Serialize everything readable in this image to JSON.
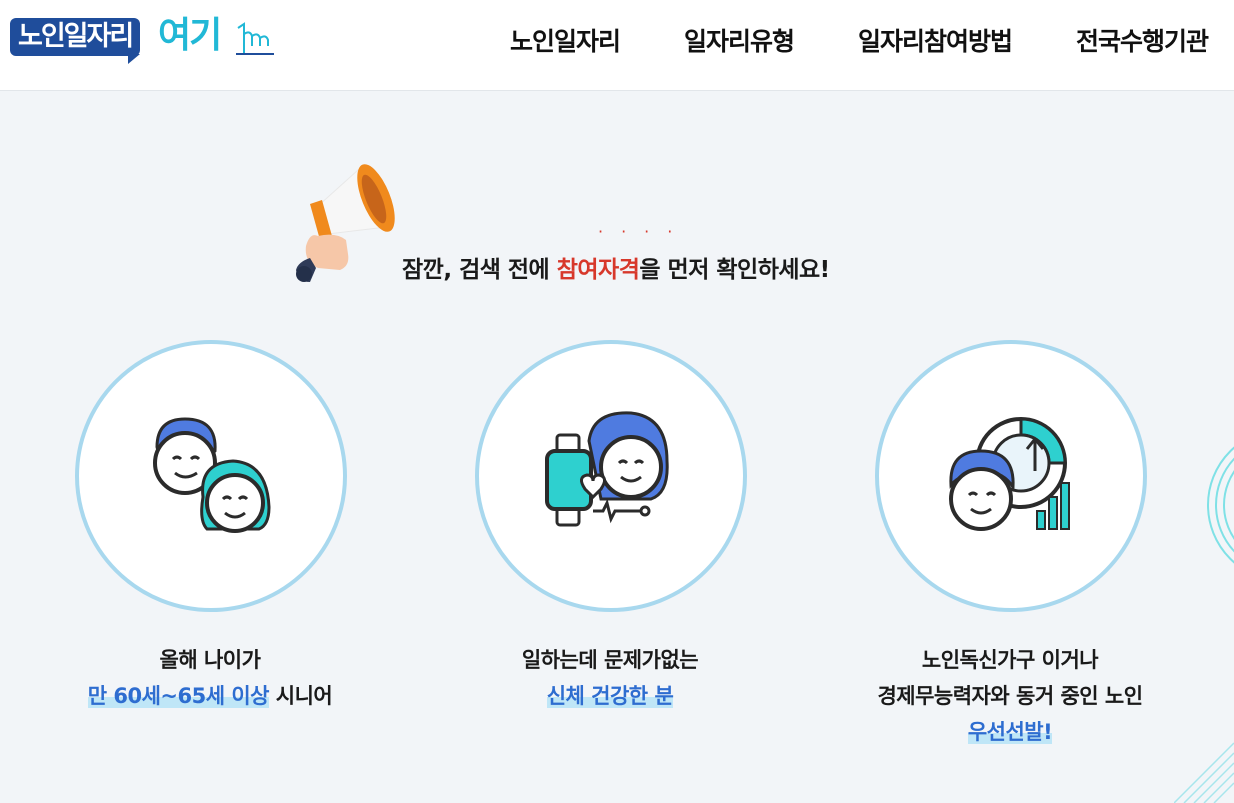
{
  "header": {
    "logo": {
      "part1": "노인일자리",
      "part2": "여기"
    },
    "nav": [
      "노인일자리",
      "일자리유형",
      "일자리참여방법",
      "전국수행기관"
    ]
  },
  "notice": {
    "prefix": "잠깐, 검색 전에 ",
    "highlight": "참여자격",
    "suffix": "을 먼저 확인하세요!",
    "dots": "····"
  },
  "cards": [
    {
      "icon": "senior-couple-icon",
      "line1": "올해 나이가",
      "highlight": "만 60세~65세 이상",
      "line2_suffix": " 시니어"
    },
    {
      "icon": "smartwatch-health-icon",
      "line1": "일하는데 문제가없는",
      "highlight": "신체 건강한 분"
    },
    {
      "icon": "senior-chart-icon",
      "line1": "노인독신가구 이거나",
      "line2": "경제무능력자와 동거 중인 노인",
      "highlight": "우선선발!"
    }
  ],
  "colors": {
    "brand_blue": "#1f4d9b",
    "brand_cyan": "#21b8d6",
    "accent_red": "#d7382b",
    "highlight_blue": "#2e6dd0",
    "circle_border": "#a8d8ee"
  }
}
